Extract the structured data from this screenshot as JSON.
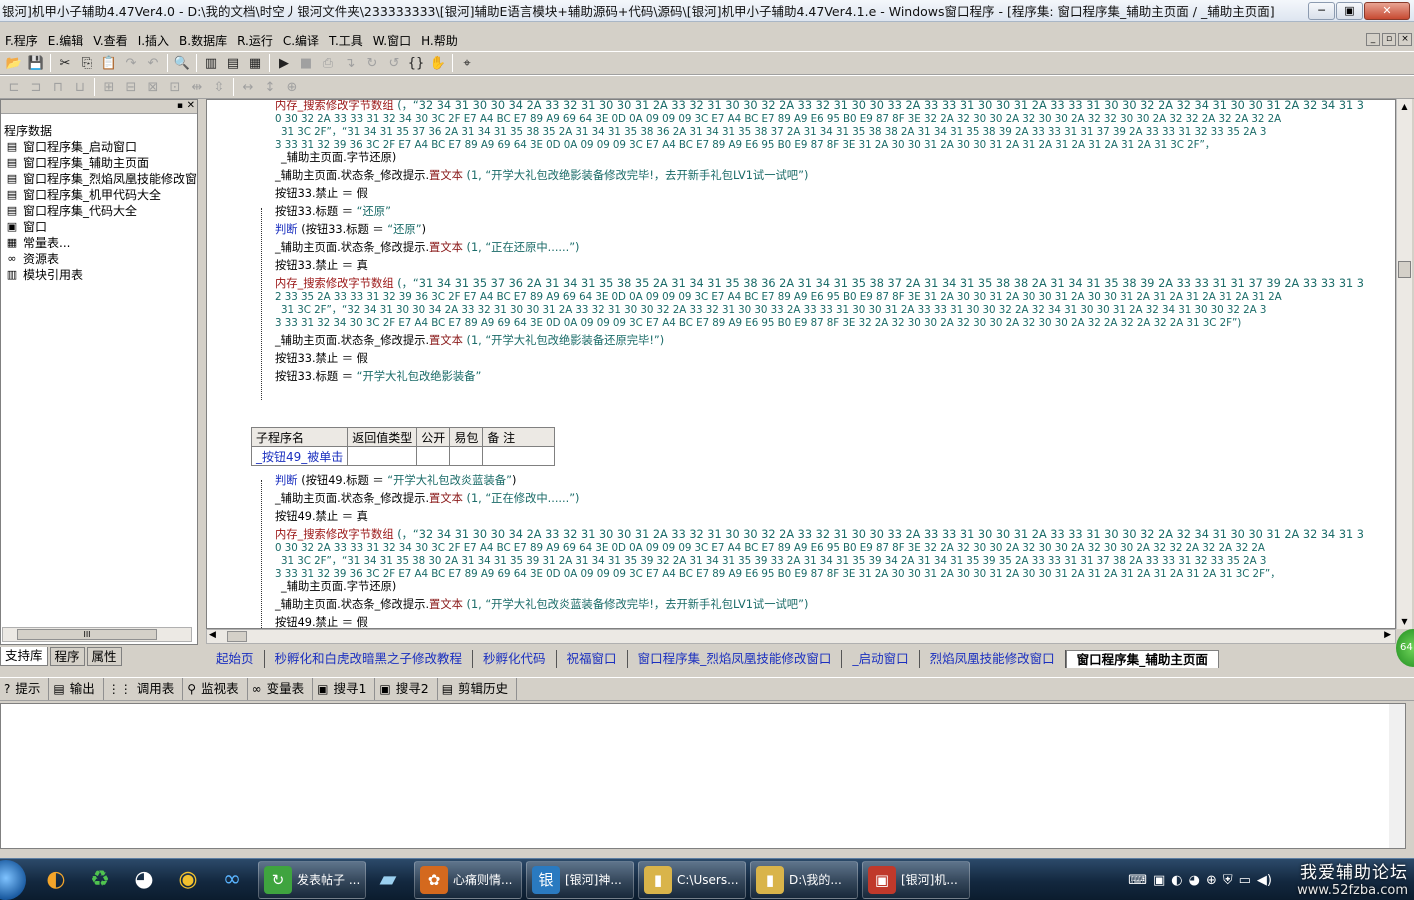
{
  "window": {
    "title": "银河]机甲小子辅助4.47Ver4.0 - D:\\我的文档\\时空丿银河文件夹\\233333333\\[银河]辅助E语言模块+辅助源码+代码\\源码\\[银河]机甲小子辅助4.47Ver4.1.e - Windows窗口程序 - [程序集: 窗口程序集_辅助主页面 / _辅助主页面]",
    "min": "─",
    "max": "▣",
    "close": "✕"
  },
  "menu": [
    "F.程序",
    "E.编辑",
    "V.查看",
    "I.插入",
    "B.数据库",
    "R.运行",
    "C.编译",
    "T.工具",
    "W.窗口",
    "H.帮助"
  ],
  "mdi": [
    "_",
    "▫",
    "×"
  ],
  "left": {
    "header_pin": "▪",
    "header_close": "✕",
    "tree": [
      {
        "icon": "",
        "label": "程序数据"
      },
      {
        "icon": "▤",
        "label": "窗口程序集_启动窗口"
      },
      {
        "icon": "▤",
        "label": "窗口程序集_辅助主页面"
      },
      {
        "icon": "▤",
        "label": "窗口程序集_烈焰凤凰技能修改窗"
      },
      {
        "icon": "▤",
        "label": "窗口程序集_机甲代码大全"
      },
      {
        "icon": "▤",
        "label": "窗口程序集_代码大全"
      },
      {
        "icon": "▣",
        "label": "窗口"
      },
      {
        "icon": "▦",
        "label": "常量表..."
      },
      {
        "icon": "∞",
        "label": "资源表"
      },
      {
        "icon": "▥",
        "label": "模块引用表"
      }
    ],
    "scroll_grip": "III",
    "tabs": [
      "支持库",
      "程序",
      "属性"
    ]
  },
  "code": {
    "l1a": "内存_搜索修改字节数组",
    "l1b": " (，“32 34 31 30 30 34 2A 33 32 31 30 30 31 2A 33 32 31 30 30 32 2A 33 32 31 30 30 33 2A 33 33 31 30 30 31 2A 33 33 31 30 30 32 2A 32 34 31 30 30 31 2A 32 34 31 3",
    "l1c": "0 30 32 2A 33 33 31 32 34 30 3C 2F E7 A4 BC E7 89 A9 69 64 3E 0D 0A 09 09 09 3C E7 A4 BC E7 89 A9 E6 95 B0 E9 87 8F 3E 32 2A 32 30 30 2A 32 30 30 2A 32 32 30 30 2A 32 32 2A 32 2A 32 2A",
    "l1d": "31 3C 2F”，“31 34 31 35 37 36 2A 31 34 31 35 38 35 2A 31 34 31 35 38 36 2A 31 34 31 35 38 37 2A 31 34 31 35 38 38 2A 31 34 31 35 38 39 2A 33 33 31 31 37 39 2A 33 33 31 32 33 35 2A 3",
    "l1e": "3 33 31 32 39 36 3C 2F E7 A4 BC E7 89 A9 69 64 3E 0D 0A 09 09 09 3C E7 A4 BC E7 89 A9 E6 95 B0 E9 87 8F 3E 31 2A 30 30 31 2A 30 30 31 2A 31 2A 31 2A 31 2A 31 2A 31 3C 2F”，",
    "l1f": "_辅助主页面.字节还原)",
    "l2": "_辅助主页面.状态条_修改提示.",
    "l2m": "置文本",
    "l2s": " (1, “开学大礼包改绝影装备修改完毕!，去开新手礼包LV1试一试吧”)",
    "l3": "按钮33.禁止 ＝ 假",
    "l4a": "按钮33.标题 ＝ ",
    "l4s": "“还原”",
    "l5k": "判断",
    "l5": " (按钮33.标题 ＝ ",
    "l5s": "“还原”",
    "l5e": ")",
    "l6": "_辅助主页面.状态条_修改提示.",
    "l6m": "置文本",
    "l6s": " (1, “正在还原中......”)",
    "l7": "按钮33.禁止 ＝ 真",
    "l8a": "内存_搜索修改字节数组",
    "l8b": " (，“31 34 31 35 37 36 2A 31 34 31 35 38 35 2A 31 34 31 35 38 36 2A 31 34 31 35 38 37 2A 31 34 31 35 38 38 2A 31 34 31 35 38 39 2A 33 33 31 31 37 39 2A 33 33 31 3",
    "l8c": "2 33 35 2A 33 33 31 32 39 36 3C 2F E7 A4 BC E7 89 A9 69 64 3E 0D 0A 09 09 09 3C E7 A4 BC E7 89 A9 E6 95 B0 E9 87 8F 3E 31 2A 30 30 31 2A 30 30 31 2A 30 30 31 2A 31 2A 31 2A 31 2A 31 2A",
    "l8d": "31 3C 2F”，“32 34 31 30 30 34 2A 33 32 31 30 30 31 2A 33 32 31 30 30 32 2A 33 32 31 30 30 33 2A 33 33 31 30 30 31 2A 33 33 31 30 30 32 2A 32 34 31 30 30 31 2A 32 34 31 30 30 32 2A 3",
    "l8e": "3 33 31 32 34 30 3C 2F E7 A4 BC E7 89 A9 69 64 3E 0D 0A 09 09 09 3C E7 A4 BC E7 89 A9 E6 95 B0 E9 87 8F 3E 32 2A 32 30 30 2A 32 30 30 2A 32 30 30 2A 32 2A 32 2A 32 2A 31 3C 2F”)",
    "l9": "_辅助主页面.状态条_修改提示.",
    "l9m": "置文本",
    "l9s": " (1, “开学大礼包改绝影装备还原完毕!”)",
    "l10": "按钮33.禁止 ＝ 假",
    "l11a": "按钮33.标题 ＝ ",
    "l11s": "“开学大礼包改绝影装备”",
    "sub_headers": [
      "子程序名",
      "返回值类型",
      "公开",
      "易包",
      "备 注"
    ],
    "sub_name": "_按钮49_被单击",
    "m1k": "判断",
    "m1": " (按钮49.标题 ＝ ",
    "m1s": "“开学大礼包改炎蓝装备”",
    "m1e": ")",
    "m2": "_辅助主页面.状态条_修改提示.",
    "m2m": "置文本",
    "m2s": " (1, “正在修改中......”)",
    "m3": "按钮49.禁止 ＝ 真",
    "m4a": "内存_搜索修改字节数组",
    "m4b": " (，“32 34 31 30 30 34 2A 33 32 31 30 30 31 2A 33 32 31 30 30 32 2A 33 32 31 30 30 33 2A 33 33 31 30 30 31 2A 33 33 31 30 30 32 2A 32 34 31 30 30 31 2A 32 34 31 3",
    "m4c": "0 30 32 2A 33 33 31 32 34 30 3C 2F E7 A4 BC E7 89 A9 69 64 3E 0D 0A 09 09 09 3C E7 A4 BC E7 89 A9 E6 95 B0 E9 87 8F 3E 32 2A 32 30 30 2A 32 30 30 2A 32 30 30 2A 32 32 2A 32 2A 32 2A",
    "m4d": "31 3C 2F”，“31 34 31 35 38 30 2A 31 34 31 35 39 31 2A 31 34 31 35 39 32 2A 31 34 31 35 39 33 2A 31 34 31 35 39 34 2A 31 34 31 35 39 35 2A 33 33 31 31 37 38 2A 33 33 31 32 33 35 2A 3",
    "m4e": "3 33 31 32 39 36 3C 2F E7 A4 BC E7 89 A9 69 64 3E 0D 0A 09 09 09 3C E7 A4 BC E7 89 A9 E6 95 B0 E9 87 8F 3E 31 2A 30 30 31 2A 30 30 31 2A 30 30 31 2A 31 2A 31 2A 31 2A 31 2A 31 3C 2F”，",
    "m4f": "_辅助主页面.字节还原)",
    "m5": "_辅助主页面.状态条_修改提示.",
    "m5m": "置文本",
    "m5s": " (1, “开学大礼包改炎蓝装备修改完毕!，去开新手礼包LV1试一试吧”)",
    "m6": "按钮49.禁止 ＝ 假"
  },
  "doctabs": [
    "起始页",
    "秒孵化和白虎改暗黑之子修改教程",
    "秒孵化代码",
    "祝福窗口",
    "窗口程序集_烈焰凤凰技能修改窗口",
    "_启动窗口",
    "烈焰凤凰技能修改窗口",
    "窗口程序集_辅助主页面"
  ],
  "outtabs": [
    {
      "icon": "?",
      "label": "提示"
    },
    {
      "icon": "▤",
      "label": "输出"
    },
    {
      "icon": "⋮⋮",
      "label": "调用表"
    },
    {
      "icon": "⚲",
      "label": "监视表"
    },
    {
      "icon": "∞",
      "label": "变量表"
    },
    {
      "icon": "▣",
      "label": "搜寻1"
    },
    {
      "icon": "▣",
      "label": "搜寻2"
    },
    {
      "icon": "▤",
      "label": "剪辑历史"
    }
  ],
  "badge": "64",
  "taskbar": {
    "tasks": [
      {
        "label": "发表帖子 ...",
        "color": "#3fa43f"
      },
      {
        "label": "心痛则情...",
        "color": "#d4691e"
      },
      {
        "label": "[银河]神...",
        "color": "#2a7ac0"
      },
      {
        "label": "C:\\Users...",
        "color": "#d9b44a"
      },
      {
        "label": "D:\\我的...",
        "color": "#d9b44a"
      },
      {
        "label": "[银河]机...",
        "color": "#c0392b"
      }
    ],
    "quick": [
      "◐",
      "♻",
      "◕",
      "◉",
      "∞"
    ]
  },
  "watermark": {
    "line1": "我爱辅助论坛",
    "line2": "www.52fzba.com"
  }
}
